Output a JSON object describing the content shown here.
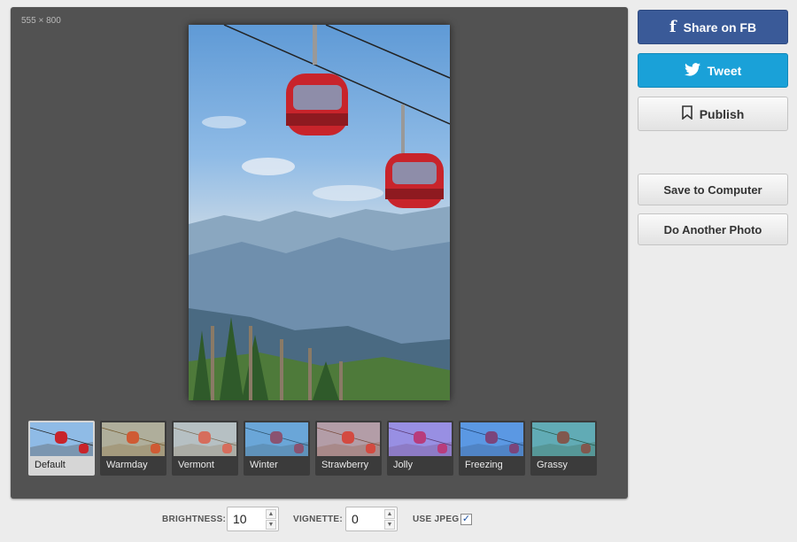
{
  "editor": {
    "dimensions_label": "555 × 800"
  },
  "filters": [
    {
      "name": "Default",
      "tint": "",
      "active": true
    },
    {
      "name": "Warmday",
      "tint": "#d8a040"
    },
    {
      "name": "Vermont",
      "tint": "#e6c79a"
    },
    {
      "name": "Winter",
      "tint": "#3e8fc8"
    },
    {
      "name": "Strawberry",
      "tint": "#e07a5a"
    },
    {
      "name": "Jolly",
      "tint": "#a35ce0"
    },
    {
      "name": "Freezing",
      "tint": "#1d6fe0"
    },
    {
      "name": "Grassy",
      "tint": "#2a9a7a"
    }
  ],
  "sidebar": {
    "share_fb_label": "Share on FB",
    "tweet_label": "Tweet",
    "publish_label": "Publish",
    "save_label": "Save to Computer",
    "another_label": "Do Another Photo",
    "fb_color": "#3a5a98",
    "twitter_color": "#1aa1d8"
  },
  "controls": {
    "brightness_label": "BRIGHTNESS:",
    "brightness_value": "10",
    "vignette_label": "VIGNETTE:",
    "vignette_value": "0",
    "jpeg_label": "USE JPEG",
    "jpeg_checked": true
  }
}
